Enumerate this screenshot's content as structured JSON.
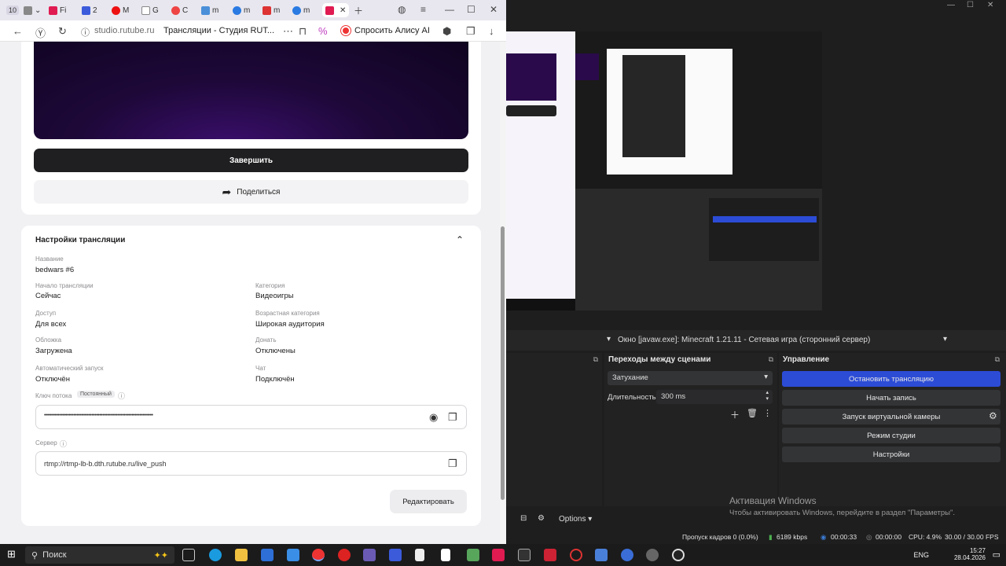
{
  "browser": {
    "tabs": [
      {
        "label": "Fi"
      },
      {
        "label": "2"
      },
      {
        "label": "M"
      },
      {
        "label": "G"
      },
      {
        "label": "C"
      },
      {
        "label": "m"
      },
      {
        "label": "m"
      },
      {
        "label": "m"
      },
      {
        "label": "m"
      }
    ],
    "active_tab_number": "10",
    "url": "studio.rutube.ru",
    "page_title": "Трансляции - Студия RUT...",
    "alisa_label": "Спросить Алису AI"
  },
  "stream": {
    "finish_label": "Завершить",
    "share_label": "Поделиться",
    "settings_title": "Настройки трансляции",
    "fields": {
      "name_label": "Название",
      "name_value": "bedwars #6",
      "start_label": "Начало трансляции",
      "start_value": "Сейчас",
      "category_label": "Категория",
      "category_value": "Видеоигры",
      "access_label": "Доступ",
      "access_value": "Для всех",
      "age_label": "Возрастная категория",
      "age_value": "Широкая аудитория",
      "cover_label": "Обложка",
      "cover_value": "Загружена",
      "donate_label": "Донать",
      "donate_value": "Отключены",
      "autostart_label": "Автоматический запуск",
      "autostart_value": "Отключён",
      "chat_label": "Чат",
      "chat_value": "Подключён"
    },
    "stream_key_label": "Ключ потока",
    "stream_key_badge": "Постоянный",
    "stream_key_value": "•••••••••••••••••••••••••••••••••••••••••••••••••••••••••••••••••••••••",
    "server_label": "Сервер",
    "server_value": "rtmp://rtmp-lb-b.dth.rutube.ru/live_push",
    "edit_label": "Редактировать"
  },
  "obs": {
    "source_bar": "Окно   [javaw.exe]: Minecraft 1.21.11 - Сетевая игра (сторонний сервер)",
    "transitions_title": "Переходы между сценами",
    "transition_value": "Затухание",
    "duration_label": "Длительность",
    "duration_value": "300 ms",
    "controls_title": "Управление",
    "controls": [
      "Остановить трансляцию",
      "Начать запись",
      "Запуск виртуальной камеры",
      "Режим студии",
      "Настройки"
    ],
    "options_label": "Options",
    "windows_activation_title": "Активация Windows",
    "windows_activation_text": "Чтобы активировать Windows, перейдите в раздел \"Параметры\".",
    "status": {
      "dropped": "Пропуск кадров 0 (0.0%)",
      "bitrate": "6189 kbps",
      "live_time": "00:00:33",
      "rec_time": "00:00:00",
      "cpu": "CPU: 4.9%",
      "fps": "30.00 / 30.00 FPS"
    }
  },
  "taskbar": {
    "search_label": "Поиск",
    "lang": "ENG",
    "time": "15:27",
    "date": "28.04.2026"
  },
  "colors": {
    "obs_accent": "#2c4cd6",
    "preview_purple": "#1e0839"
  }
}
